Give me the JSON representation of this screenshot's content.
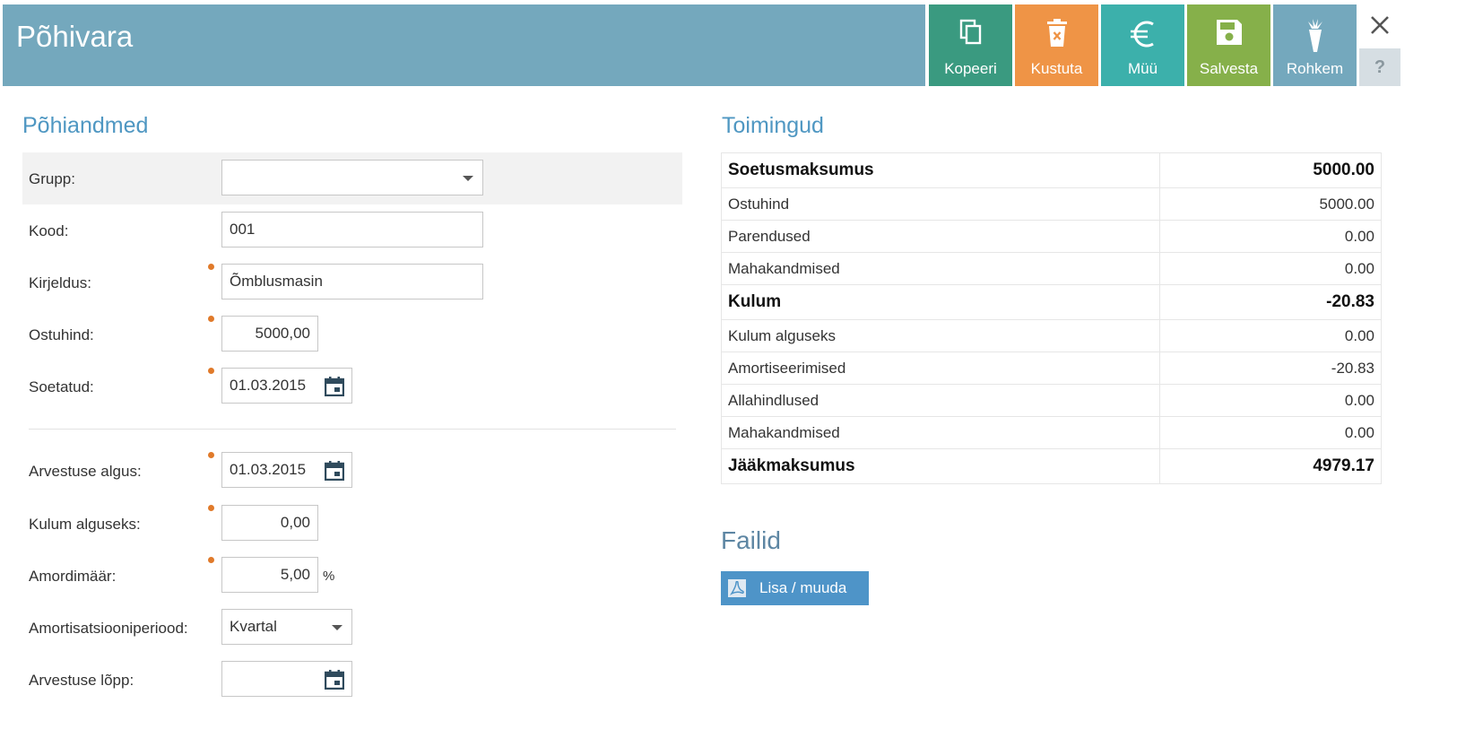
{
  "header": {
    "title": "Põhivara",
    "buttons": {
      "copy": "Kopeeri",
      "delete": "Kustuta",
      "sell": "Müü",
      "save": "Salvesta",
      "more": "Rohkem"
    },
    "help": "?"
  },
  "left": {
    "title": "Põhiandmed",
    "fields": {
      "grupp": {
        "label": "Grupp:",
        "value": ""
      },
      "kood": {
        "label": "Kood:",
        "value": "001"
      },
      "kirjeldus": {
        "label": "Kirjeldus:",
        "value": "Õmblusmasin"
      },
      "ostuhind": {
        "label": "Ostuhind:",
        "value": "5000,00"
      },
      "soetatud": {
        "label": "Soetatud:",
        "value": "01.03.2015"
      },
      "arvestuse_algus": {
        "label": "Arvestuse algus:",
        "value": "01.03.2015"
      },
      "kulum_alguseks": {
        "label": "Kulum alguseks:",
        "value": "0,00"
      },
      "amordimaar": {
        "label": "Amordimäär:",
        "value": "5,00",
        "unit": "%"
      },
      "amortisatsiooniperiood": {
        "label": "Amortisatsiooniperiood:",
        "value": "Kvartal"
      },
      "arvestuse_lopp": {
        "label": "Arvestuse lõpp:",
        "value": ""
      }
    }
  },
  "right": {
    "title": "Toimingud",
    "rows": [
      {
        "label": "Soetusmaksumus",
        "value": "5000.00",
        "bold": true
      },
      {
        "label": "Ostuhind",
        "value": "5000.00",
        "bold": false
      },
      {
        "label": "Parendused",
        "value": "0.00",
        "bold": false
      },
      {
        "label": "Mahakandmised",
        "value": "0.00",
        "bold": false
      },
      {
        "label": "Kulum",
        "value": "-20.83",
        "bold": true
      },
      {
        "label": "Kulum alguseks",
        "value": "0.00",
        "bold": false
      },
      {
        "label": "Amortiseerimised",
        "value": "-20.83",
        "bold": false
      },
      {
        "label": "Allahindlused",
        "value": "0.00",
        "bold": false
      },
      {
        "label": "Mahakandmised",
        "value": "0.00",
        "bold": false
      },
      {
        "label": "Jääkmaksumus",
        "value": "4979.17",
        "bold": true
      }
    ],
    "files_title": "Failid",
    "files_button": "Lisa / muuda"
  },
  "colors": {
    "header": "#74a8bd",
    "copy": "#3a9a80",
    "delete": "#ef9446",
    "sell": "#3cb0ab",
    "save": "#86b04a",
    "section_title": "#4f97c2",
    "required_dot": "#e07a2a",
    "files_button": "#4e94c8"
  },
  "icons": [
    "copy-icon",
    "trash-icon",
    "euro-icon",
    "floppy-disk-icon",
    "carrot-icon",
    "close-icon",
    "calendar-icon",
    "pdf-icon"
  ]
}
